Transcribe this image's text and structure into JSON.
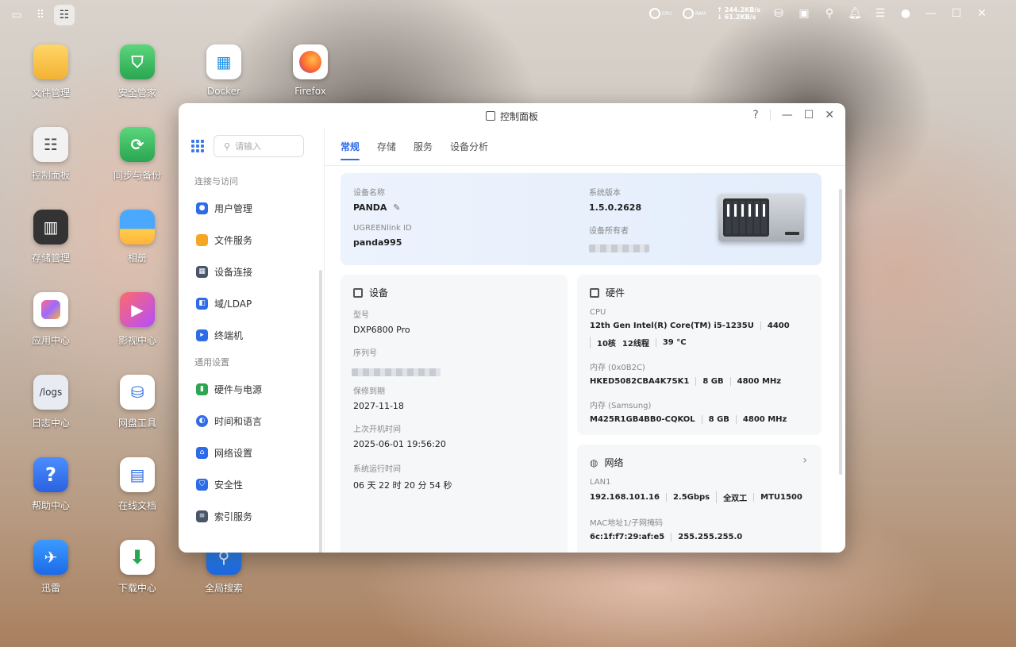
{
  "topbar": {
    "cpu_label": "CPU",
    "ram_label": "RAM",
    "upload_speed": "↑ 244.2KB/s",
    "download_speed": "↓ 61.2KB/s"
  },
  "desktop": {
    "icons": [
      {
        "label": "文件管理"
      },
      {
        "label": "安全管家"
      },
      {
        "label": "Docker"
      },
      {
        "label": "Firefox"
      },
      {
        "label": "控制面板"
      },
      {
        "label": "同步与备份"
      },
      {
        "label": "存储管理"
      },
      {
        "label": "相册"
      },
      {
        "label": "应用中心"
      },
      {
        "label": "影视中心"
      },
      {
        "label": "日志中心"
      },
      {
        "label": "网盘工具"
      },
      {
        "label": "帮助中心"
      },
      {
        "label": "在线文档"
      },
      {
        "label": "迅雷"
      },
      {
        "label": "下载中心"
      },
      {
        "label": "全局搜索"
      }
    ],
    "logs_tile_text": "/logs"
  },
  "window": {
    "title": "控制面板",
    "help": "?"
  },
  "sidebar": {
    "search_placeholder": "请输入",
    "group1": "连接与访问",
    "group2": "通用设置",
    "items": [
      {
        "label": "用户管理"
      },
      {
        "label": "文件服务"
      },
      {
        "label": "设备连接"
      },
      {
        "label": "域/LDAP"
      },
      {
        "label": "终端机"
      },
      {
        "label": "硬件与电源"
      },
      {
        "label": "时间和语言"
      },
      {
        "label": "网络设置"
      },
      {
        "label": "安全性"
      },
      {
        "label": "索引服务"
      }
    ]
  },
  "tabs": [
    {
      "label": "常规"
    },
    {
      "label": "存储"
    },
    {
      "label": "服务"
    },
    {
      "label": "设备分析"
    }
  ],
  "overview": {
    "device_name_label": "设备名称",
    "device_name": "PANDA",
    "ugreen_id_label": "UGREENlink ID",
    "ugreen_id": "panda995",
    "version_label": "系统版本",
    "version": "1.5.0.2628",
    "owner_label": "设备所有者"
  },
  "device_card": {
    "title": "设备",
    "model_label": "型号",
    "model": "DXP6800 Pro",
    "serial_label": "序列号",
    "warranty_label": "保修到期",
    "warranty": "2027-11-18",
    "boot_label": "上次开机时间",
    "boot": "2025-06-01 19:56:20",
    "uptime_label": "系统运行时间",
    "uptime": "06 天 22 时 20 分 54 秒"
  },
  "hardware_card": {
    "title": "硬件",
    "cpu_label": "CPU",
    "cpu_specs": [
      "12th Gen Intel(R) Core(TM) i5-1235U",
      "4400",
      "10核",
      "12线程",
      "39 °C"
    ],
    "mem1_label": "内存 (0x0B2C)",
    "mem1_specs": [
      "HKED5082CBA4K7SK1",
      "8 GB",
      "4800 MHz"
    ],
    "mem2_label": "内存 (Samsung)",
    "mem2_specs": [
      "M425R1GB4BB0-CQKOL",
      "8 GB",
      "4800 MHz"
    ]
  },
  "network_card": {
    "title": "网络",
    "lan_label": "LAN1",
    "lan_specs": [
      "192.168.101.16",
      "2.5Gbps",
      "全双工",
      "MTU1500"
    ],
    "mac_label": "MAC地址1/子网掩码",
    "mac_specs": [
      "6c:1f:f7:29:af:e5",
      "255.255.255.0"
    ]
  }
}
